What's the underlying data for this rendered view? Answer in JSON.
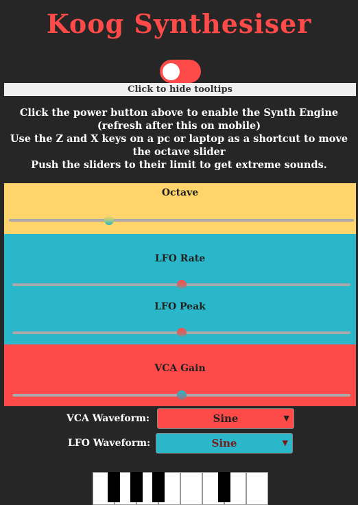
{
  "app": {
    "title": "Koog Synthesiser"
  },
  "power": {
    "state": "off"
  },
  "tooltip_toggle": {
    "label": "Click to hide tooltips"
  },
  "instructions": {
    "line1": "Click the power button above to enable the Synth Engine",
    "line2": "(refresh after this on mobile)",
    "line3": "Use the Z and X keys on a pc or laptop as a shortcut to move",
    "line4": "the octave slider",
    "line5": "Push the sliders to their limit to get extreme sounds."
  },
  "sliders": {
    "octave": {
      "label": "Octave",
      "value_fraction": 0.29
    },
    "lfo_rate": {
      "label": "LFO Rate",
      "value_fraction": 0.5
    },
    "lfo_peak": {
      "label": "LFO Peak",
      "value_fraction": 0.5
    },
    "vca_gain": {
      "label": "VCA Gain",
      "value_fraction": 0.5
    }
  },
  "selects": {
    "vca_waveform": {
      "label": "VCA Waveform:",
      "value": "Sine"
    },
    "lfo_waveform": {
      "label": "LFO Waveform:",
      "value": "Sine"
    }
  },
  "colors": {
    "accent_red": "#fe4b49",
    "yellow": "#ffd56b",
    "teal": "#2ab7ca",
    "background": "#262626"
  }
}
